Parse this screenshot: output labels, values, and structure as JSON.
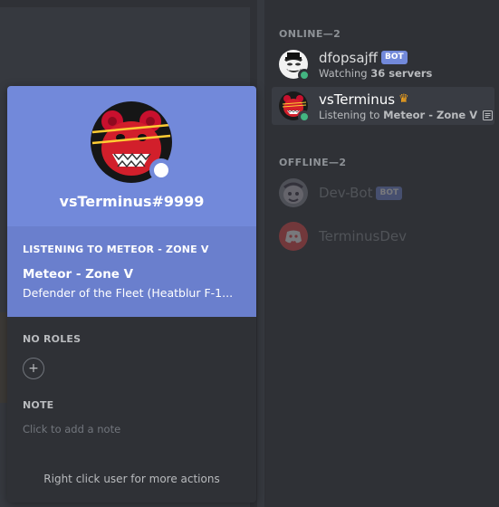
{
  "popout": {
    "username": "vsTerminus#9999",
    "activity_heading": "LISTENING TO METEOR - ZONE V",
    "activity_name": "Meteor - Zone V",
    "activity_details": "Defender of the Fleet (Heatblur F-1...",
    "roles_heading": "NO ROLES",
    "add_role_symbol": "+",
    "note_heading": "NOTE",
    "note_placeholder": "Click to add a note",
    "footer": "Right click user for more actions",
    "header_color": "#7289da",
    "status_color": "#ffffff"
  },
  "members": {
    "online_heading": "ONLINE—2",
    "offline_heading": "OFFLINE—2",
    "online": [
      {
        "name": "dfopsajff",
        "tag": "BOT",
        "activity_prefix": "Watching ",
        "activity_value": "36 servers",
        "avatar": "trollface-avatar-icon",
        "status": "online"
      },
      {
        "name": "vsTerminus",
        "crown": "♛",
        "activity_prefix": "Listening to ",
        "activity_value": "Meteor - Zone V",
        "avatar": "red-bear-avatar-icon",
        "status": "online",
        "selected": true
      }
    ],
    "offline": [
      {
        "name": "Dev-Bot",
        "tag": "BOT",
        "avatar": "gray-creature-avatar-icon"
      },
      {
        "name": "TerminusDev",
        "avatar": "discord-logo-avatar-icon"
      }
    ]
  },
  "colors": {
    "blurple": "#7289da",
    "online_green": "#43b581",
    "crown": "#faa61a",
    "background": "#36393f",
    "sidebar": "#2f3136"
  }
}
